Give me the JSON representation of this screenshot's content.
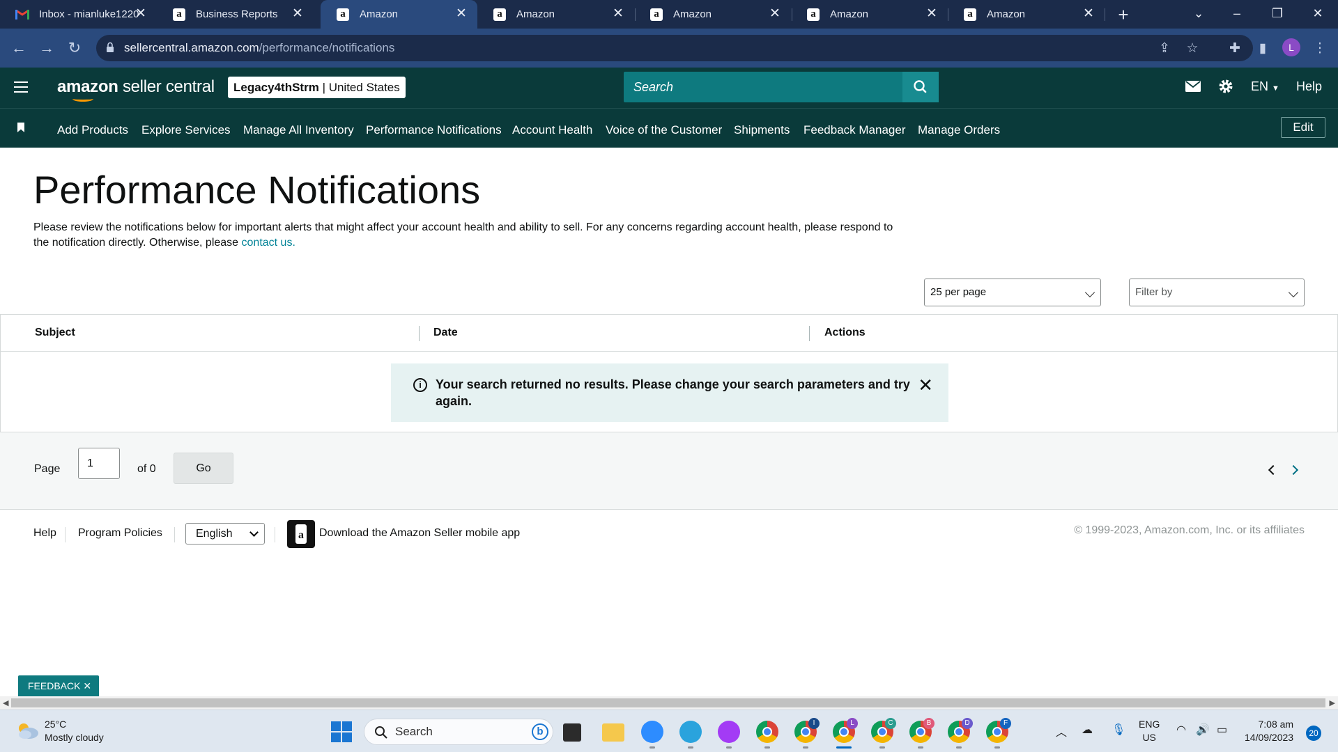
{
  "browser": {
    "tabs": [
      {
        "title": "Inbox - mianluke1220",
        "icon": "gmail-icon",
        "active": false
      },
      {
        "title": "Business Reports",
        "icon": "amazon-icon",
        "active": false
      },
      {
        "title": "Amazon",
        "icon": "amazon-icon",
        "active": true
      },
      {
        "title": "Amazon",
        "icon": "amazon-icon",
        "active": false
      },
      {
        "title": "Amazon",
        "icon": "amazon-icon",
        "active": false
      },
      {
        "title": "Amazon",
        "icon": "amazon-icon",
        "active": false
      },
      {
        "title": "Amazon",
        "icon": "amazon-icon",
        "active": false
      }
    ],
    "url_host": "sellercentral.amazon.com",
    "url_path": "/performance/notifications",
    "profile_initial": "L"
  },
  "header": {
    "logo_brand": "amazon",
    "logo_product": "seller central",
    "store_name": "Legacy4thStrm",
    "store_region": "| United States",
    "search_placeholder": "Search",
    "language": "EN",
    "help": "Help"
  },
  "nav": {
    "items": [
      "Add Products",
      "Explore Services",
      "Manage All Inventory",
      "Performance Notifications",
      "Account Health",
      "Voice of the Customer",
      "Shipments",
      "Feedback Manager",
      "Manage Orders"
    ],
    "edit_label": "Edit"
  },
  "main": {
    "title": "Performance Notifications",
    "intro": "Please review the notifications below for important alerts that might affect your account health and ability to sell. For any concerns regarding account health, please respond to the notification directly. Otherwise, please ",
    "contact_link": "contact us.",
    "per_page": "25 per page",
    "filter_placeholder": "Filter by",
    "columns": [
      "Subject",
      "Date",
      "Actions"
    ],
    "empty_message": "Your search returned no results. Please change your search parameters and try again.",
    "pager": {
      "page_label": "Page",
      "page_value": "1",
      "of_label": "of 0",
      "go_label": "Go"
    }
  },
  "footer": {
    "help": "Help",
    "program_policies": "Program Policies",
    "language_value": "English",
    "app_download": "Download the Amazon Seller mobile app",
    "copyright": "© 1999-2023, Amazon.com, Inc. or its affiliates"
  },
  "feedback_tab": "FEEDBACK",
  "taskbar": {
    "temperature": "25°C",
    "weather": "Mostly cloudy",
    "search_placeholder": "Search",
    "lang_top": "ENG",
    "lang_bottom": "US",
    "time": "7:08 am",
    "date": "14/09/2023",
    "notifications": "20",
    "pinned": [
      "windows-start-icon",
      "search-icon",
      "task-view-icon",
      "file-explorer-icon",
      "zoom-icon",
      "telegram-icon",
      "messenger-icon",
      "chrome-icon",
      "chrome-profile-i-icon",
      "chrome-profile-l-icon",
      "chrome-profile-c-icon",
      "chrome-profile-b-icon",
      "chrome-profile-d-icon",
      "chrome-profile-f-icon"
    ],
    "chrome_badges": [
      "",
      "I",
      "L",
      "C",
      "B",
      "D",
      "F"
    ]
  },
  "colors": {
    "amazon_header": "#0a3a3a",
    "search_teal": "#0e7a7f",
    "link_teal": "#008296",
    "alert_bg": "#e6f2f2",
    "chrome_tabbar": "#1b2b4a",
    "chrome_active": "#2a4a7d"
  }
}
